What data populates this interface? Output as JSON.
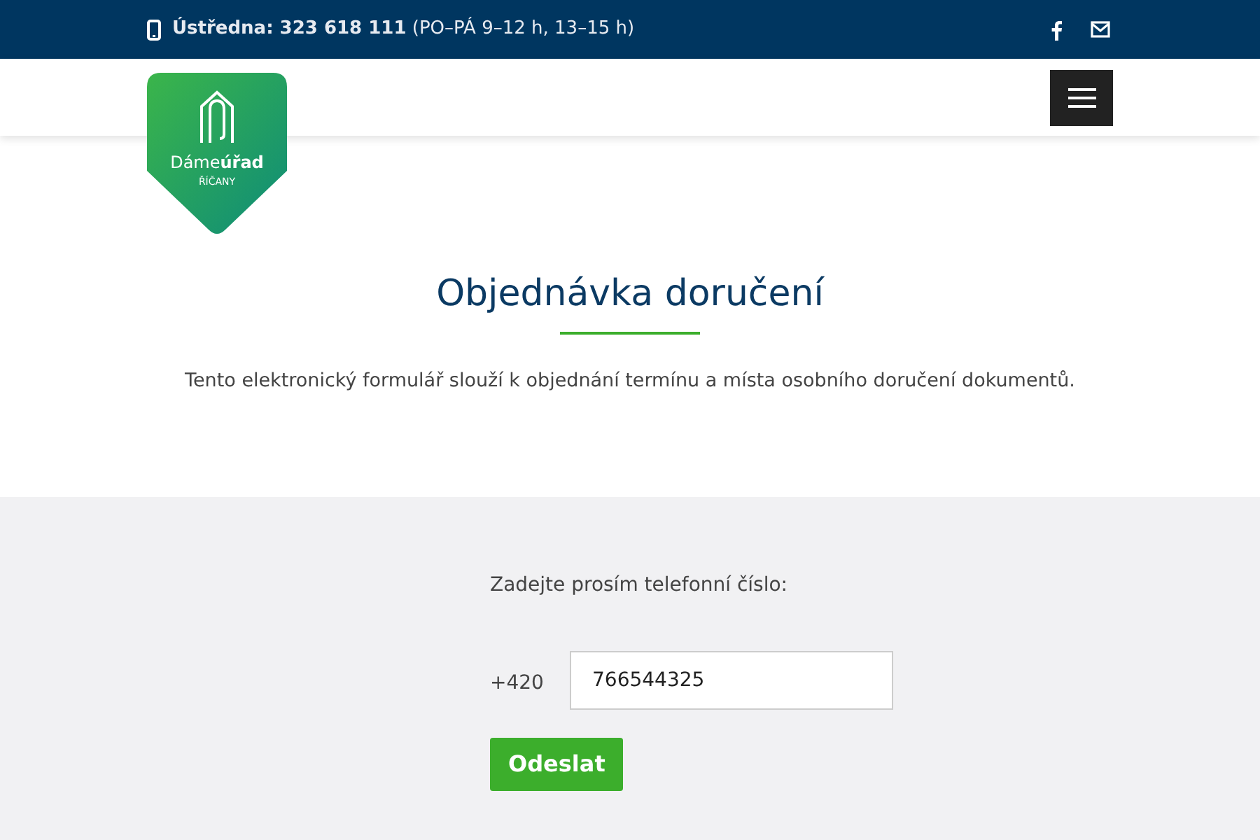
{
  "top_bar": {
    "phone": "**Ústředna: 323 618 111** (PO–PÁ 9–12 h, 13–15 h)"
  },
  "logo": {
    "name": "Dáme**úřad**",
    "town": "ŘÍČANY"
  },
  "hero": {
    "title": "Objednávka doručení",
    "text": "Tento elektronický formulář slouží k objednání termínu a místa osobního doručení dokumentů."
  },
  "form": {
    "label": "Zadejte prosím telefonní číslo:",
    "prefix": "+420",
    "phone_value": "766544325",
    "submit": "Odeslat"
  }
}
